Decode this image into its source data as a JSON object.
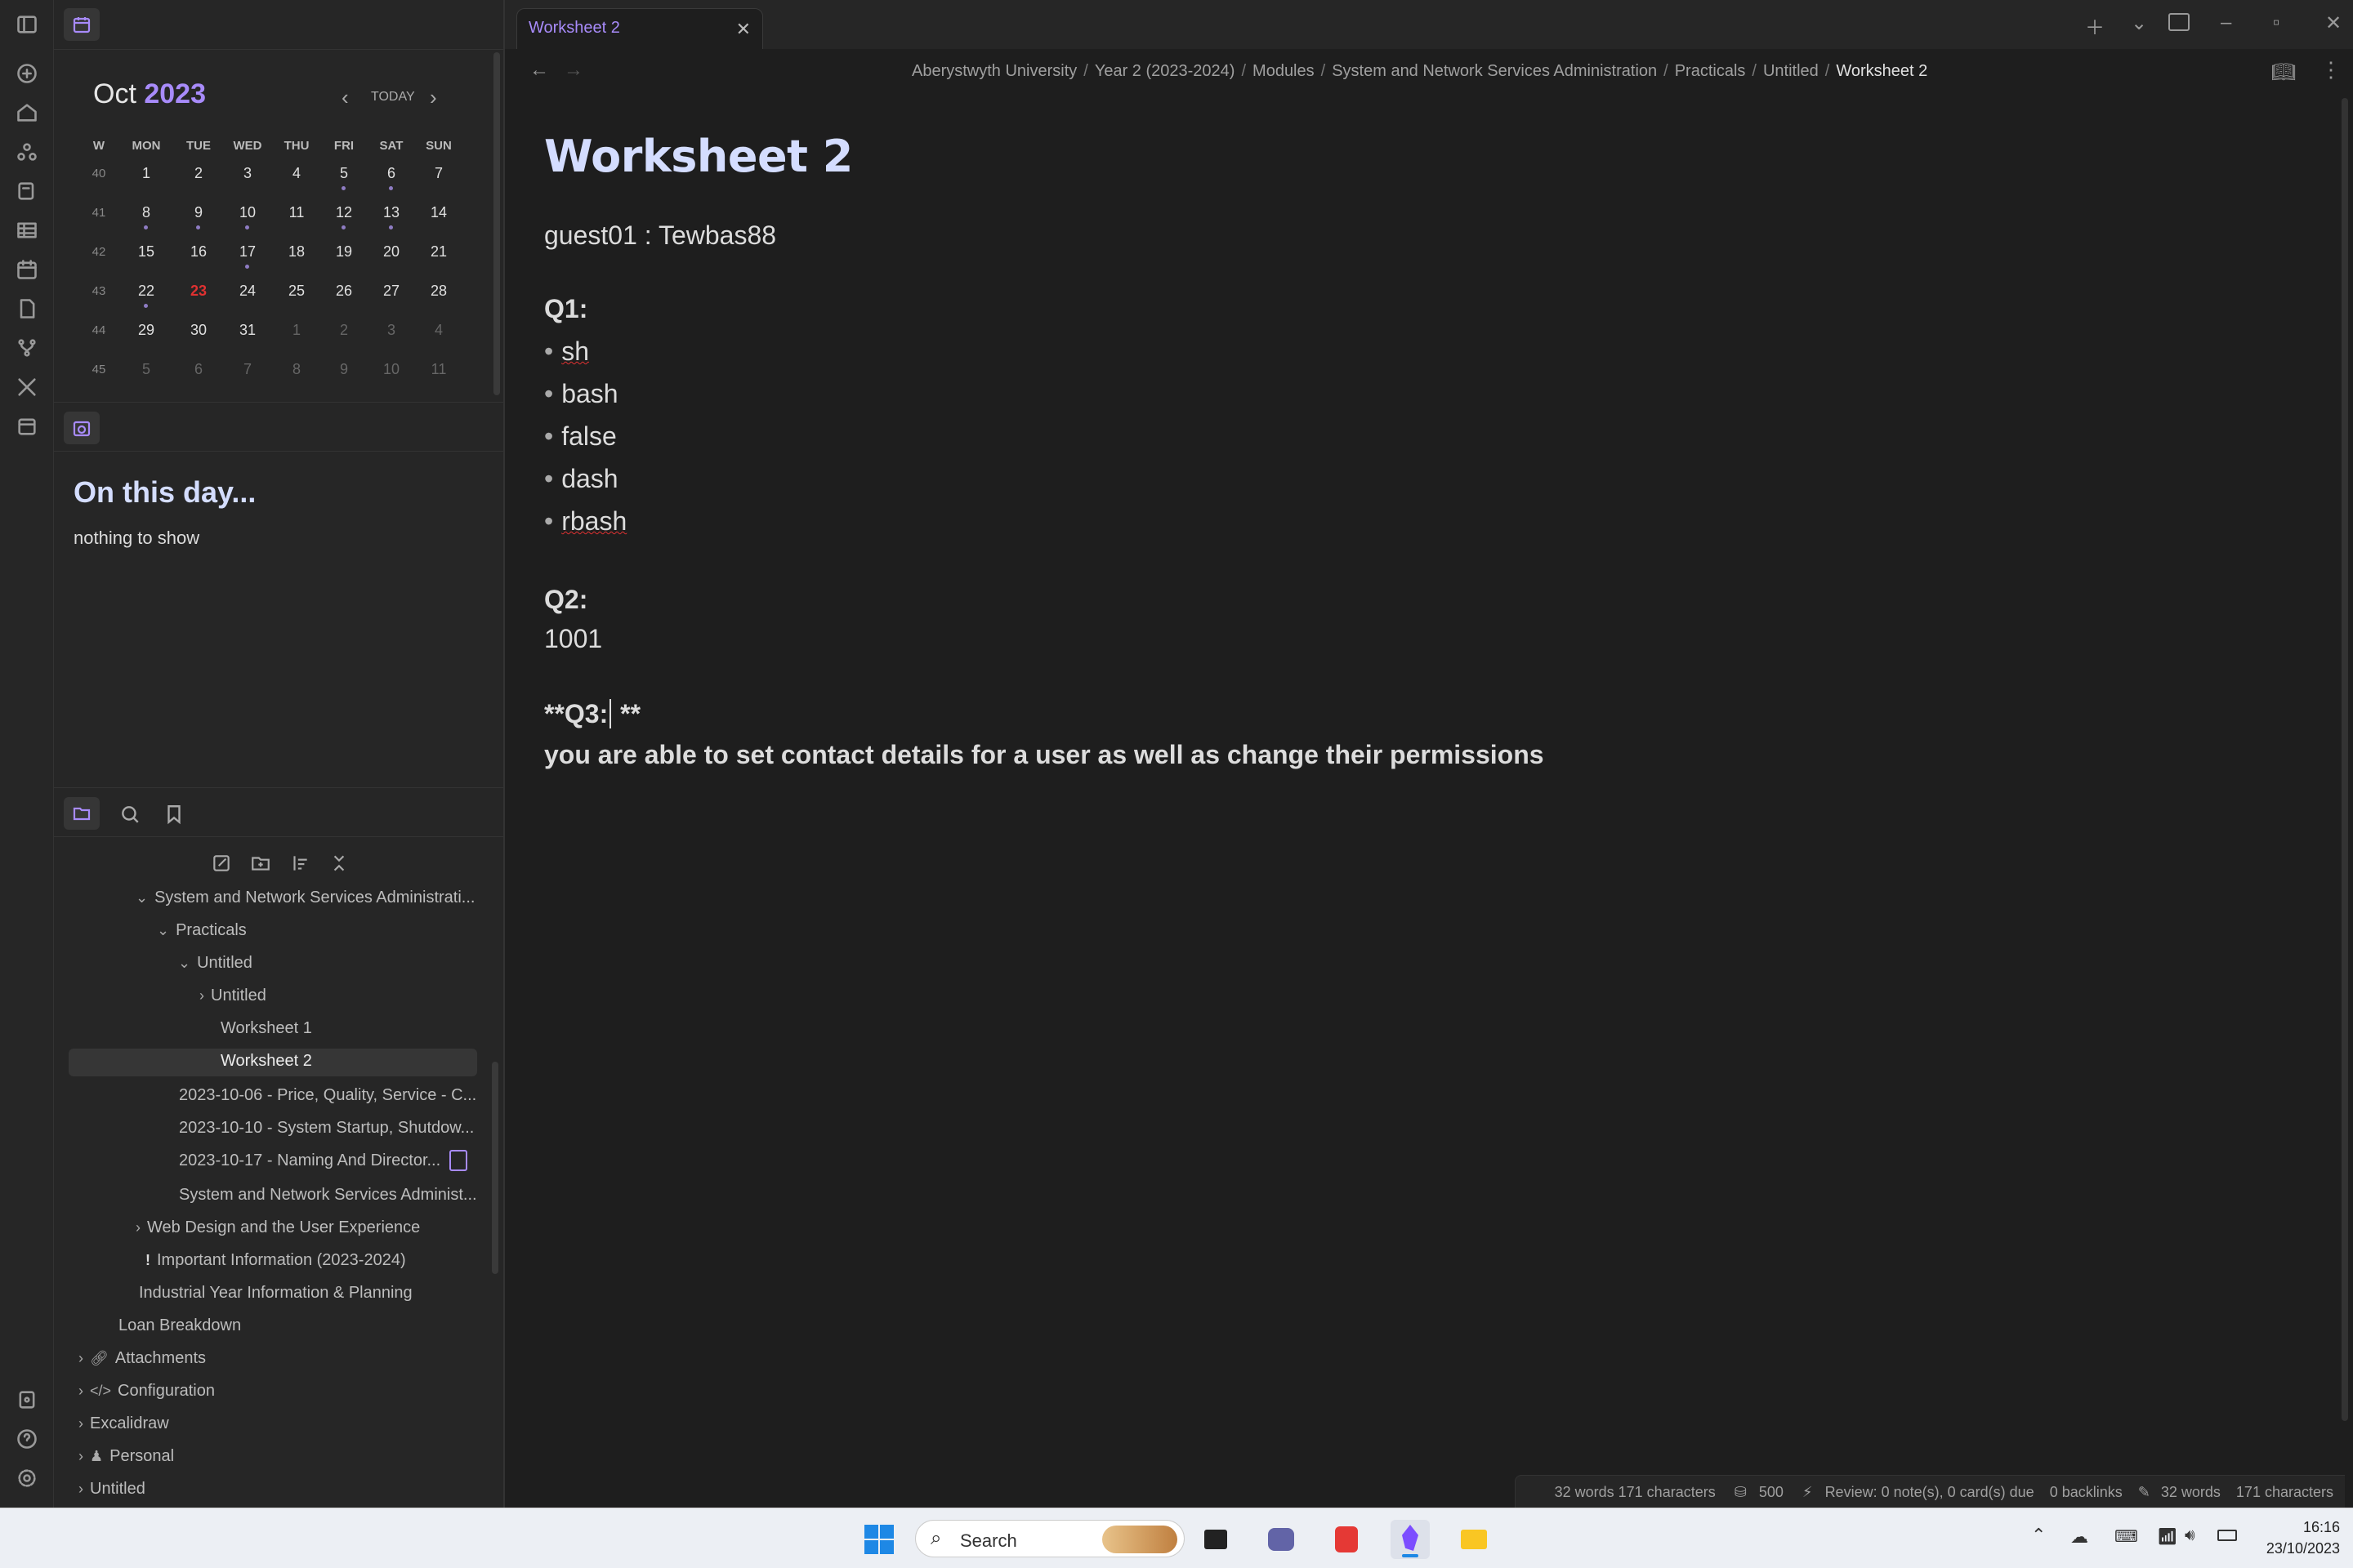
{
  "tab": {
    "title": "Worksheet 2"
  },
  "breadcrumbs": [
    "Aberystwyth University",
    "Year 2 (2023-2024)",
    "Modules",
    "System and Network Services Administration",
    "Practicals",
    "Untitled",
    "Worksheet 2"
  ],
  "calendar": {
    "month": "Oct",
    "year": "2023",
    "today_label": "TODAY",
    "headers": [
      "W",
      "MON",
      "TUE",
      "WED",
      "THU",
      "FRI",
      "SAT",
      "SUN"
    ],
    "weeks": [
      {
        "w": "40",
        "days": [
          "1",
          "2",
          "3",
          "4",
          "5",
          "6",
          "7"
        ]
      },
      {
        "w": "41",
        "days": [
          "8",
          "9",
          "10",
          "11",
          "12",
          "13",
          "14"
        ]
      },
      {
        "w": "42",
        "days": [
          "15",
          "16",
          "17",
          "18",
          "19",
          "20",
          "21"
        ]
      },
      {
        "w": "43",
        "days": [
          "22",
          "23",
          "24",
          "25",
          "26",
          "27",
          "28"
        ]
      },
      {
        "w": "44",
        "days": [
          "29",
          "30",
          "31",
          "1",
          "2",
          "3",
          "4"
        ]
      },
      {
        "w": "45",
        "days": [
          "5",
          "6",
          "7",
          "8",
          "9",
          "10",
          "11"
        ]
      }
    ],
    "today": "23",
    "accent": "#a88bfa",
    "today_color": "#e03131"
  },
  "on_this_day": {
    "title": "On this day...",
    "empty": "nothing to show"
  },
  "tree": [
    "System and Network Services Administrati...",
    "Practicals",
    "Untitled",
    "Untitled",
    "Worksheet 1",
    "Worksheet 2",
    "2023-10-06 - Price, Quality, Service - C...",
    "2023-10-10 - System Startup, Shutdow...",
    "2023-10-17 - Naming And Director...",
    "System and Network Services Administ...",
    "Web Design and the User Experience",
    "Important Information (2023-2024)",
    "Industrial Year Information & Planning",
    "Loan Breakdown",
    "Attachments",
    "Configuration",
    "Excalidraw",
    "Personal",
    "Untitled"
  ],
  "note": {
    "title": "Worksheet 2",
    "line1": "guest01 : Tewbas88",
    "q1": "Q1:",
    "q1_items": [
      "sh",
      "bash",
      "false",
      "dash",
      "rbash"
    ],
    "q2": "Q2:",
    "q2_answer": "1001",
    "q3_pre": "**Q3:",
    "q3_post": " **",
    "q3_answer": "you are able to set contact details for a user as well as change their permissions"
  },
  "status": {
    "words": "32 words 171 characters",
    "goal": "500",
    "review": "Review: 0 note(s), 0 card(s) due",
    "backlinks": "0 backlinks",
    "words2": "32 words",
    "chars2": "171 characters"
  },
  "taskbar": {
    "search": "Search",
    "time": "16:16",
    "date": "23/10/2023"
  }
}
